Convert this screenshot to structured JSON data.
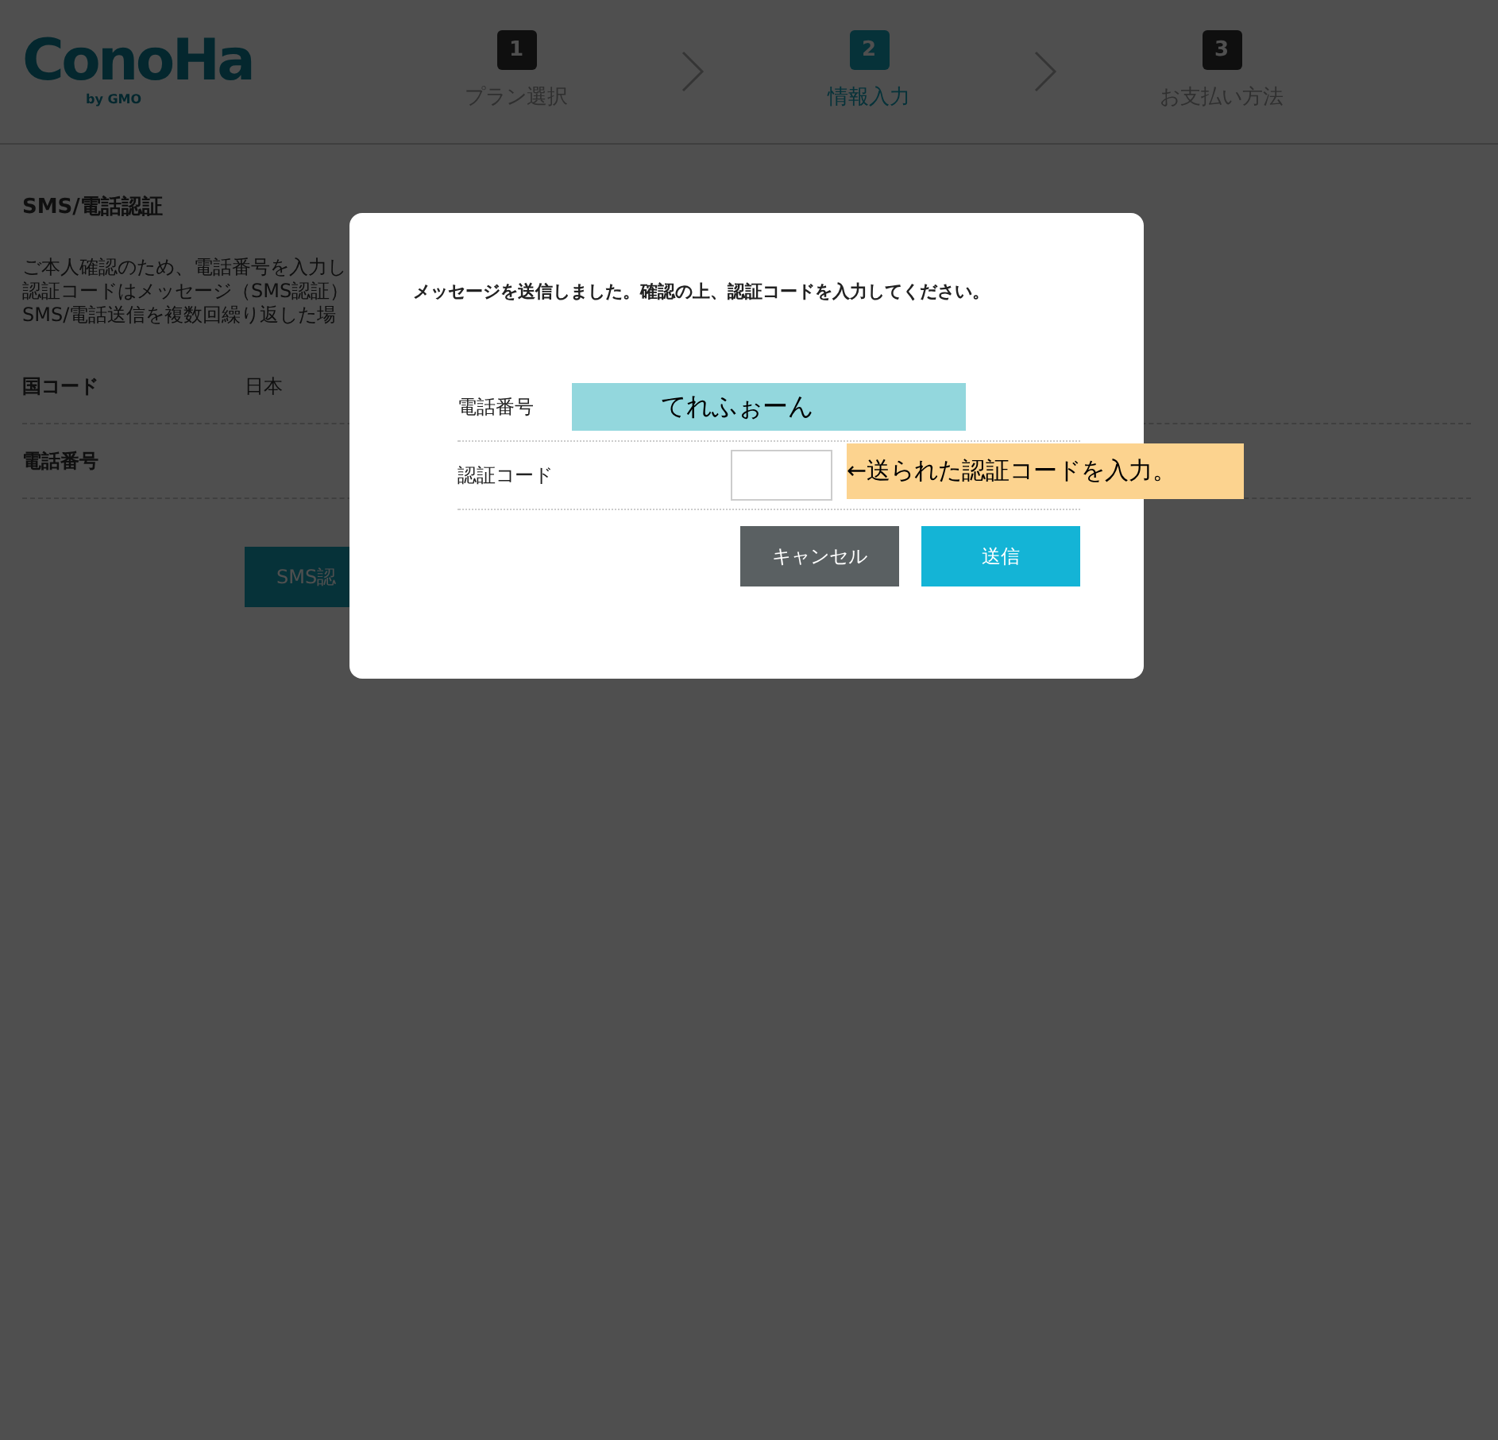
{
  "logo": {
    "name": "ConoHa",
    "sub": "by GMO"
  },
  "steps": [
    {
      "number": "1",
      "label": "プラン選択",
      "selected": false
    },
    {
      "number": "2",
      "label": "情報入力",
      "selected": true
    },
    {
      "number": "3",
      "label": "お支払い方法",
      "selected": false
    }
  ],
  "section": {
    "title": "SMS/電話認証",
    "lines": [
      "ご本人確認のため、電話番号を入力し",
      "認証コードはメッセージ（SMS認証）",
      "SMS/電話送信を複数回繰り返した場"
    ],
    "rows": [
      {
        "label": "国コード",
        "value": "日本"
      },
      {
        "label": "電話番号"
      }
    ],
    "button": "SMS認"
  },
  "dialog": {
    "message": "メッセージを送信しました。確認の上、認証コードを入力してください。",
    "fields": [
      {
        "label": "電話番号",
        "kind": "masked",
        "mask": "てれふぉーん"
      },
      {
        "label": "認証コード",
        "kind": "input",
        "note": "←送られた認証コードを入力。"
      }
    ],
    "buttons": [
      {
        "label": "キャンセル",
        "kind": "cancel"
      },
      {
        "label": "送信",
        "kind": "submit"
      }
    ]
  }
}
